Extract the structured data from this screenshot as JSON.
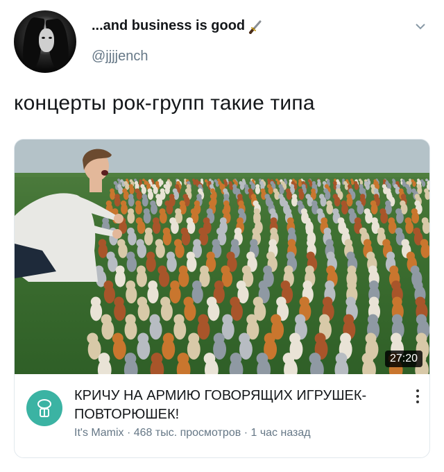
{
  "tweet": {
    "display_name": "...and business is good",
    "name_emoji": "dagger-icon",
    "username": "@jjjjench",
    "text": "концерты рок-групп такие типа"
  },
  "video_card": {
    "duration": "27:20",
    "title": "КРИЧУ НА АРМИЮ ГОВОРЯЩИХ ИГРУШЕК-ПОВТОРЮШЕК!",
    "channel": "It's Mamix",
    "views": "468 тыс. просмотров",
    "age": "1 час назад",
    "separator": "·",
    "channel_color": "#3bb3a3"
  }
}
